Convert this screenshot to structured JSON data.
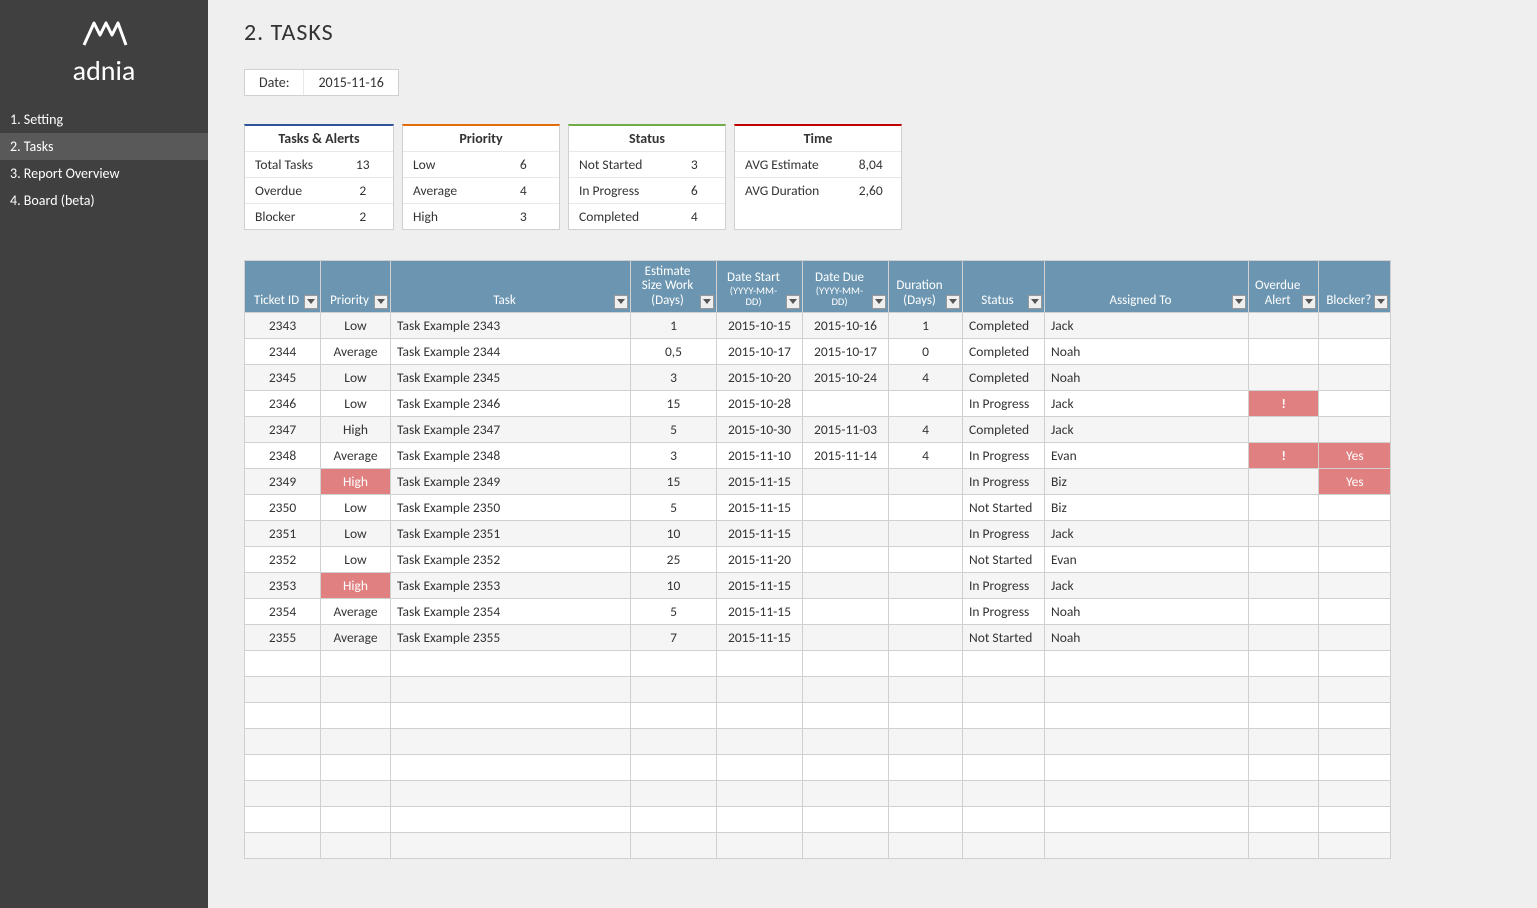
{
  "brand": {
    "icon": "ᐊᐊᐊ",
    "name": "adnia"
  },
  "nav": {
    "items": [
      "1. Setting",
      "2. Tasks",
      "3. Report Overview",
      "4. Board (beta)"
    ],
    "active_index": 1
  },
  "page_title": "2. TASKS",
  "date": {
    "label": "Date:",
    "value": "2015-11-16"
  },
  "summary": {
    "tasks_alerts": {
      "title": "Tasks & Alerts",
      "rows": [
        {
          "label": "Total Tasks",
          "value": "13"
        },
        {
          "label": "Overdue",
          "value": "2"
        },
        {
          "label": "Blocker",
          "value": "2"
        }
      ]
    },
    "priority": {
      "title": "Priority",
      "rows": [
        {
          "label": "Low",
          "value": "6"
        },
        {
          "label": "Average",
          "value": "4"
        },
        {
          "label": "High",
          "value": "3"
        }
      ]
    },
    "status": {
      "title": "Status",
      "rows": [
        {
          "label": "Not Started",
          "value": "3"
        },
        {
          "label": "In Progress",
          "value": "6"
        },
        {
          "label": "Completed",
          "value": "4"
        }
      ]
    },
    "time": {
      "title": "Time",
      "rows": [
        {
          "label": "AVG Estimate",
          "value": "8,04"
        },
        {
          "label": "AVG Duration",
          "value": "2,60"
        }
      ]
    }
  },
  "table": {
    "headers": [
      {
        "label": "Ticket ID",
        "sub": ""
      },
      {
        "label": "Priority",
        "sub": ""
      },
      {
        "label": "Task",
        "sub": ""
      },
      {
        "label": "Estimate Size Work (Days)",
        "sub": ""
      },
      {
        "label": "Date Start",
        "sub": "(YYYY-MM-DD)"
      },
      {
        "label": "Date Due",
        "sub": "(YYYY-MM-DD)"
      },
      {
        "label": "Duration (Days)",
        "sub": ""
      },
      {
        "label": "Status",
        "sub": ""
      },
      {
        "label": "Assigned To",
        "sub": ""
      },
      {
        "label": "Overdue Alert",
        "sub": ""
      },
      {
        "label": "Blocker?",
        "sub": ""
      }
    ],
    "rows": [
      {
        "ticket": "2343",
        "priority": "Low",
        "pflag": false,
        "task": "Task Example 2343",
        "est": "1",
        "dstart": "2015-10-15",
        "ddue": "2015-10-16",
        "dur": "1",
        "status": "Completed",
        "assigned": "Jack",
        "overdue": "",
        "blocker": ""
      },
      {
        "ticket": "2344",
        "priority": "Average",
        "pflag": false,
        "task": "Task Example 2344",
        "est": "0,5",
        "dstart": "2015-10-17",
        "ddue": "2015-10-17",
        "dur": "0",
        "status": "Completed",
        "assigned": "Noah",
        "overdue": "",
        "blocker": ""
      },
      {
        "ticket": "2345",
        "priority": "Low",
        "pflag": false,
        "task": "Task Example 2345",
        "est": "3",
        "dstart": "2015-10-20",
        "ddue": "2015-10-24",
        "dur": "4",
        "status": "Completed",
        "assigned": "Noah",
        "overdue": "",
        "blocker": ""
      },
      {
        "ticket": "2346",
        "priority": "Low",
        "pflag": false,
        "task": "Task Example 2346",
        "est": "15",
        "dstart": "2015-10-28",
        "ddue": "",
        "dur": "",
        "status": "In Progress",
        "assigned": "Jack",
        "overdue": "!",
        "blocker": ""
      },
      {
        "ticket": "2347",
        "priority": "High",
        "pflag": false,
        "task": "Task Example 2347",
        "est": "5",
        "dstart": "2015-10-30",
        "ddue": "2015-11-03",
        "dur": "4",
        "status": "Completed",
        "assigned": "Jack",
        "overdue": "",
        "blocker": ""
      },
      {
        "ticket": "2348",
        "priority": "Average",
        "pflag": false,
        "task": "Task Example 2348",
        "est": "3",
        "dstart": "2015-11-10",
        "ddue": "2015-11-14",
        "dur": "4",
        "status": "In Progress",
        "assigned": "Evan",
        "overdue": "!",
        "blocker": "Yes"
      },
      {
        "ticket": "2349",
        "priority": "High",
        "pflag": true,
        "task": "Task Example 2349",
        "est": "15",
        "dstart": "2015-11-15",
        "ddue": "",
        "dur": "",
        "status": "In Progress",
        "assigned": "Biz",
        "overdue": "",
        "blocker": "Yes"
      },
      {
        "ticket": "2350",
        "priority": "Low",
        "pflag": false,
        "task": "Task Example 2350",
        "est": "5",
        "dstart": "2015-11-15",
        "ddue": "",
        "dur": "",
        "status": "Not Started",
        "assigned": "Biz",
        "overdue": "",
        "blocker": ""
      },
      {
        "ticket": "2351",
        "priority": "Low",
        "pflag": false,
        "task": "Task Example 2351",
        "est": "10",
        "dstart": "2015-11-15",
        "ddue": "",
        "dur": "",
        "status": "In Progress",
        "assigned": "Jack",
        "overdue": "",
        "blocker": ""
      },
      {
        "ticket": "2352",
        "priority": "Low",
        "pflag": false,
        "task": "Task Example 2352",
        "est": "25",
        "dstart": "2015-11-20",
        "ddue": "",
        "dur": "",
        "status": "Not Started",
        "assigned": "Evan",
        "overdue": "",
        "blocker": ""
      },
      {
        "ticket": "2353",
        "priority": "High",
        "pflag": true,
        "task": "Task Example 2353",
        "est": "10",
        "dstart": "2015-11-15",
        "ddue": "",
        "dur": "",
        "status": "In Progress",
        "assigned": "Jack",
        "overdue": "",
        "blocker": ""
      },
      {
        "ticket": "2354",
        "priority": "Average",
        "pflag": false,
        "task": "Task Example 2354",
        "est": "5",
        "dstart": "2015-11-15",
        "ddue": "",
        "dur": "",
        "status": "In Progress",
        "assigned": "Noah",
        "overdue": "",
        "blocker": ""
      },
      {
        "ticket": "2355",
        "priority": "Average",
        "pflag": false,
        "task": "Task Example 2355",
        "est": "7",
        "dstart": "2015-11-15",
        "ddue": "",
        "dur": "",
        "status": "Not Started",
        "assigned": "Noah",
        "overdue": "",
        "blocker": ""
      }
    ],
    "empty_rows": 8
  }
}
